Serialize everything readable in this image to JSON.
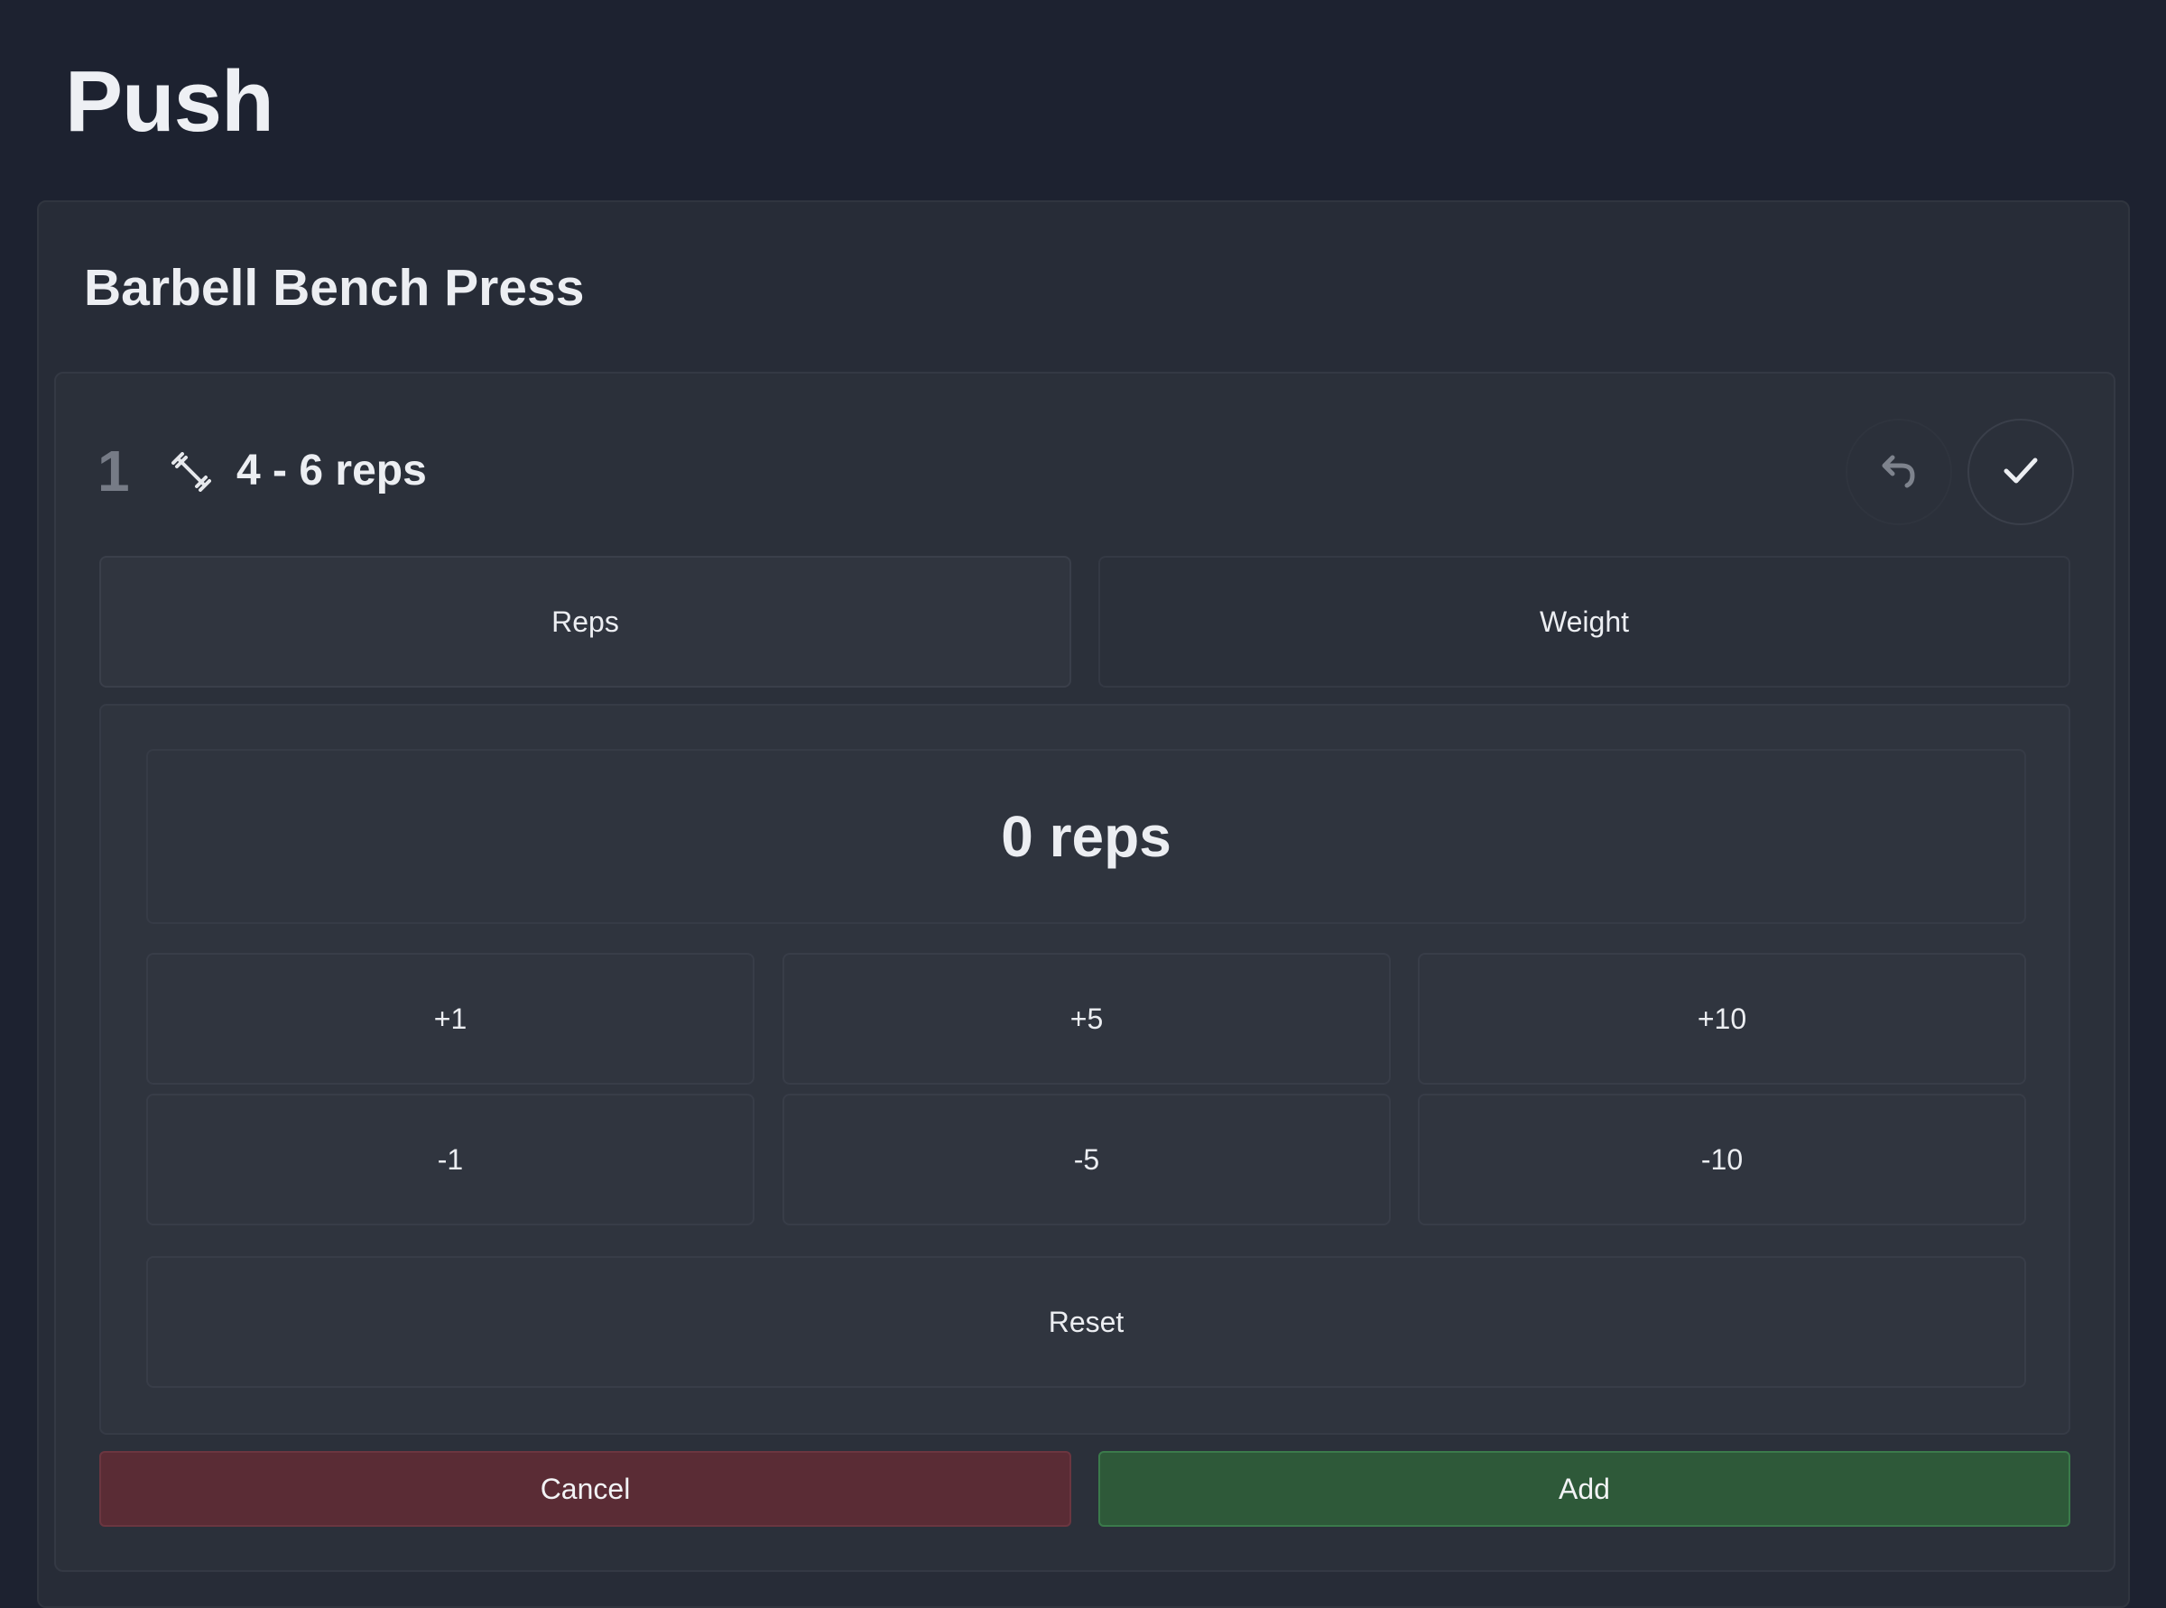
{
  "page": {
    "title": "Push"
  },
  "exercise": {
    "name": "Barbell Bench Press",
    "set": {
      "number": "1",
      "icon": "dumbbell-icon",
      "rep_range": "4 - 6 reps",
      "undo_icon": "undo-icon",
      "confirm_icon": "check-icon"
    },
    "tabs": {
      "reps": "Reps",
      "weight": "Weight",
      "active": "Reps"
    },
    "counter": {
      "display": "0 reps",
      "increments": [
        "+1",
        "+5",
        "+10"
      ],
      "decrements": [
        "-1",
        "-5",
        "-10"
      ],
      "reset": "Reset"
    },
    "actions": {
      "cancel": "Cancel",
      "add": "Add"
    }
  },
  "colors": {
    "background": "#1d2230",
    "cancel": "#5a2c35",
    "add": "#2e5939"
  }
}
